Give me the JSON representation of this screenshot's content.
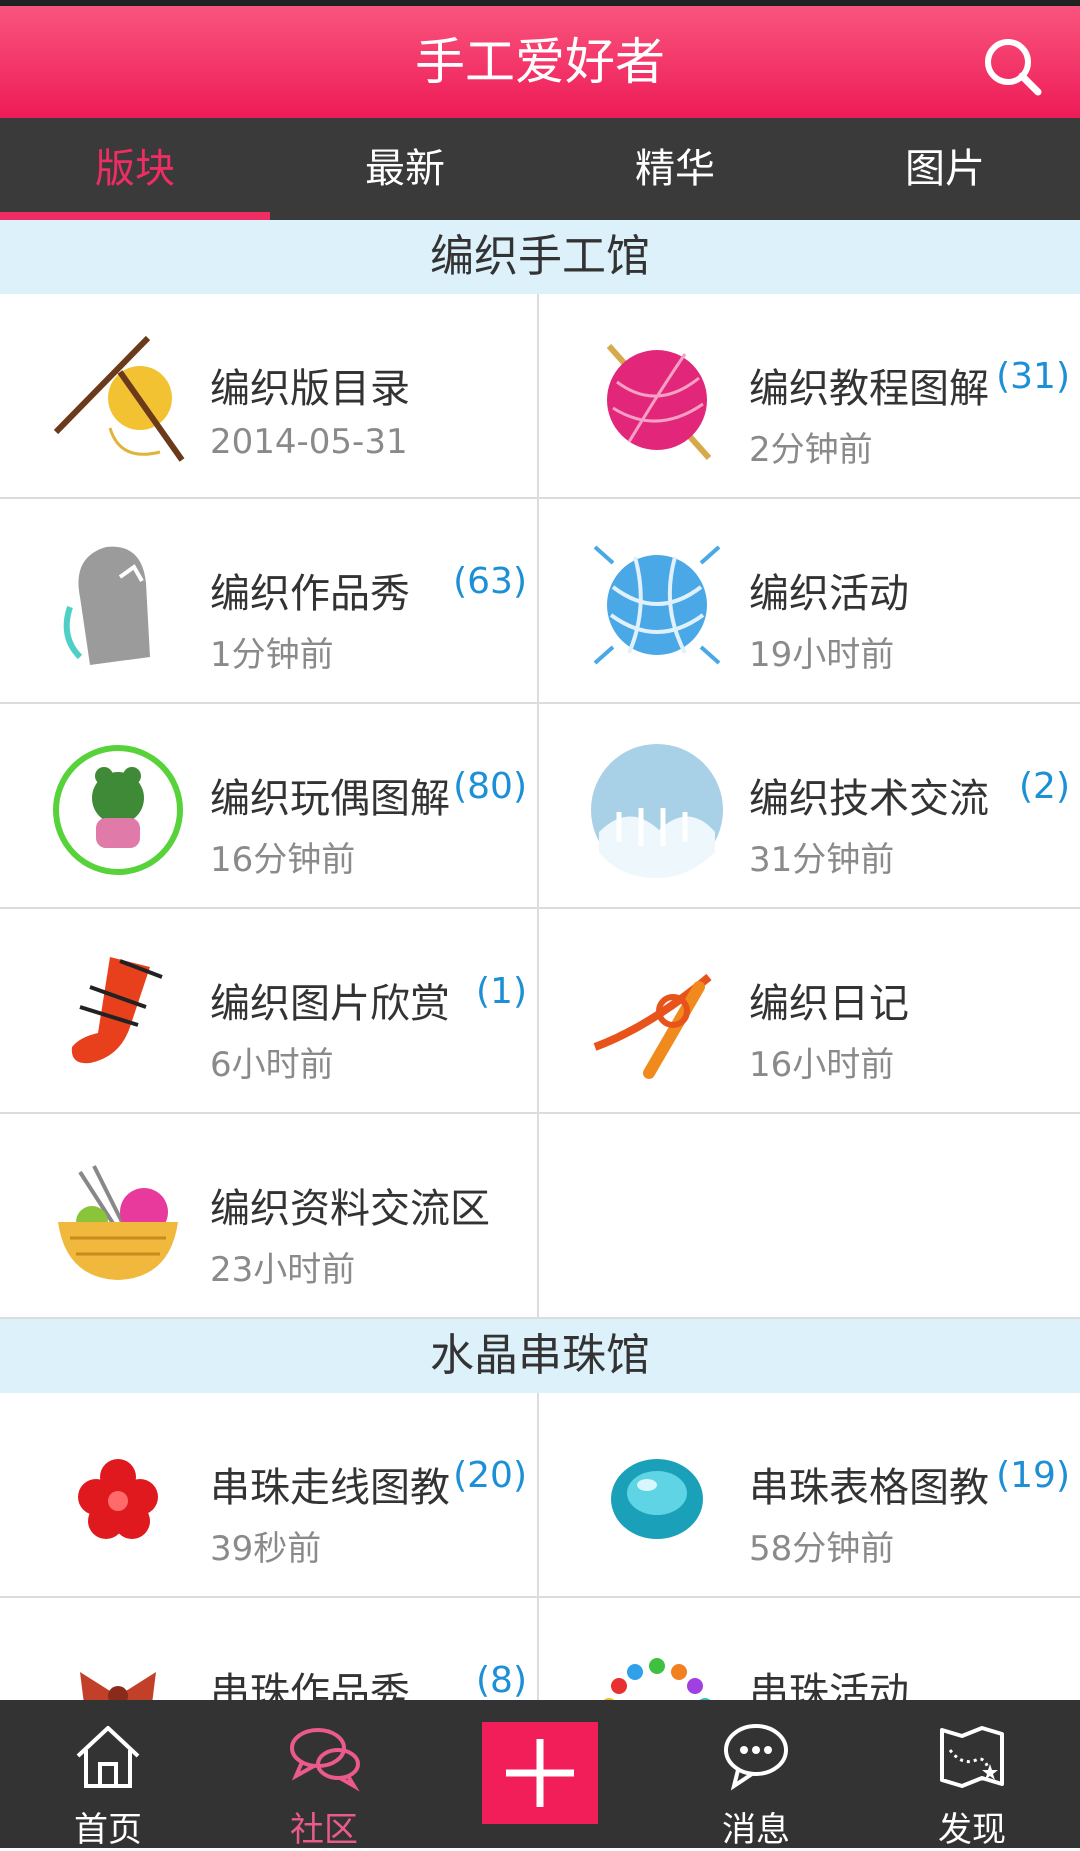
{
  "header": {
    "title": "手工爱好者",
    "search_icon": "search-icon"
  },
  "tabs": [
    {
      "label": "版块",
      "active": true
    },
    {
      "label": "最新"
    },
    {
      "label": "精华"
    },
    {
      "label": "图片"
    }
  ],
  "sections": [
    {
      "title": "编织手工馆",
      "forums": [
        {
          "name": "编织版目录",
          "count": "",
          "time": "2014-05-31",
          "icon": "knitting-needles-yarn-icon"
        },
        {
          "name": "编织教程图解",
          "count": "(31)",
          "time": "2分钟前",
          "icon": "pink-yarn-ball-icon"
        },
        {
          "name": "编织作品秀",
          "count": "(63)",
          "time": "1分钟前",
          "icon": "knitted-sweater-icon"
        },
        {
          "name": "编织活动",
          "count": "",
          "time": "19小时前",
          "icon": "blue-yarn-ball-icon"
        },
        {
          "name": "编织玩偶图解",
          "count": "(80)",
          "time": "16分钟前",
          "icon": "frog-doll-icon"
        },
        {
          "name": "编织技术交流",
          "count": "(2)",
          "time": "31分钟前",
          "icon": "knit-stitch-icon"
        },
        {
          "name": "编织图片欣赏",
          "count": "(1)",
          "time": "6小时前",
          "icon": "red-sock-icon"
        },
        {
          "name": "编织日记",
          "count": "",
          "time": "16小时前",
          "icon": "orange-knot-icon"
        },
        {
          "name": "编织资料交流区",
          "count": "",
          "time": "23小时前",
          "icon": "yarn-basket-icon"
        }
      ]
    },
    {
      "title": "水晶串珠馆",
      "forums": [
        {
          "name": "串珠走线图教",
          "count": "(20)",
          "time": "39秒前",
          "icon": "red-flower-bead-icon"
        },
        {
          "name": "串珠表格图教",
          "count": "(19)",
          "time": "58分钟前",
          "icon": "blue-crystal-bead-icon"
        },
        {
          "name": "串珠作品秀",
          "count": "(8)",
          "time": "",
          "icon": "bow-bead-icon"
        },
        {
          "name": "串珠活动",
          "count": "",
          "time": "",
          "icon": "bead-bracelet-icon"
        }
      ]
    }
  ],
  "bottom_nav": [
    {
      "label": "首页",
      "icon": "home-icon"
    },
    {
      "label": "社区",
      "icon": "chat-bubbles-icon",
      "active": true
    },
    {
      "label": "",
      "icon": "plus-icon"
    },
    {
      "label": "消息",
      "icon": "message-icon"
    },
    {
      "label": "发现",
      "icon": "map-icon"
    }
  ],
  "colors": {
    "primary": "#ef2d63",
    "tab_bar": "#3a3a3a",
    "section_bg": "#ddf1fb",
    "count": "#1c8fd6"
  }
}
